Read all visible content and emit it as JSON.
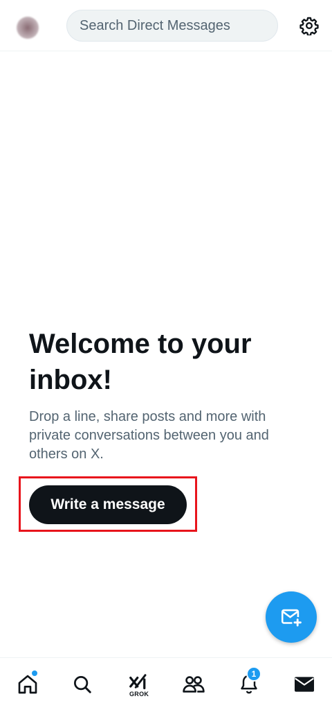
{
  "header": {
    "search_placeholder": "Search Direct Messages"
  },
  "empty_state": {
    "title": "Welcome to your inbox!",
    "description": "Drop a line, share posts and more with private conversations between you and others on X.",
    "button_label": "Write a message"
  },
  "bottom_nav": {
    "items": [
      {
        "icon": "home-icon",
        "badge": "dot"
      },
      {
        "icon": "search-icon"
      },
      {
        "icon": "grok-icon",
        "label": "GROK"
      },
      {
        "icon": "communities-icon"
      },
      {
        "icon": "notifications-icon",
        "badge_count": "1"
      },
      {
        "icon": "messages-icon",
        "active": true
      }
    ]
  },
  "colors": {
    "accent": "#1d9bf0",
    "text_primary": "#0f1419",
    "text_secondary": "#536471",
    "highlight": "#e8141c"
  }
}
